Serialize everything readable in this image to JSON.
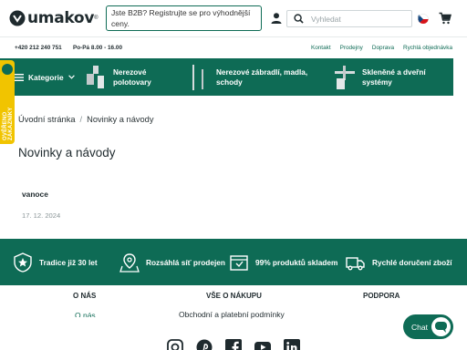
{
  "header": {
    "logo_text": "umakov",
    "logo_reg": "®",
    "b2b_text": "Jste B2B? Registrujte se pro výhodnější ceny.",
    "search_placeholder": "Vyhledat"
  },
  "topbar": {
    "phone": "+420 212 240 751",
    "hours": "Po-Pá 8.00 - 16.00",
    "links": [
      "Kontakt",
      "Prodejny",
      "Doprava",
      "Rychlá objednávka"
    ]
  },
  "nav": {
    "kategorie": "Kategorie",
    "items": [
      {
        "label_1": "Nerezové",
        "label_2": "polotovary"
      },
      {
        "label_1": "Nerezové zábradlí, madla,",
        "label_2": "schody"
      },
      {
        "label_1": "Skleněné a dveřní",
        "label_2": "systémy"
      }
    ]
  },
  "side_badge": "OVĚŘENO ZÁKAZNÍKY",
  "breadcrumb": {
    "home": "Úvodní stránka",
    "sep": "/",
    "current": "Novinky a návody"
  },
  "page_title": "Novinky a návody",
  "article": {
    "title": "vanoce",
    "date": "17. 12. 2024"
  },
  "benefits": [
    "Tradice již 30 let",
    "Rozsáhlá síť prodejen",
    "99% produktů skladem",
    "Rychlé doručení zboží"
  ],
  "footer": {
    "headings": [
      "O NÁS",
      "VŠE O NÁKUPU",
      "PODPORA"
    ],
    "links": [
      "O nás",
      "Obchodní a platební podmínky"
    ]
  },
  "chat_label": "Chat",
  "colors": {
    "brand_green": "#0e6b55",
    "badge_yellow": "#f1c400"
  }
}
